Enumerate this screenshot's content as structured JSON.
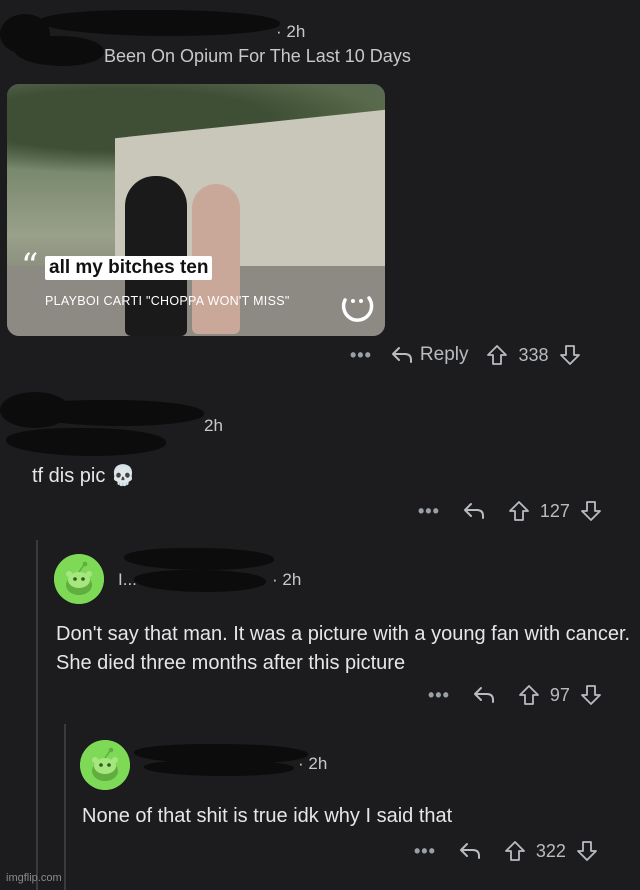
{
  "post": {
    "time": "· 2h",
    "flair": "Been On Opium For The Last 10 Days",
    "media": {
      "caption": "all my bitches ten",
      "subcaption": "PLAYBOI CARTI \"CHOPPA WON'T MISS\""
    },
    "actions": {
      "more": "•••",
      "reply": "Reply",
      "score": "338"
    }
  },
  "comments": [
    {
      "time": "2h",
      "body": "tf dis pic 💀",
      "actions": {
        "more": "•••",
        "score": "127"
      }
    },
    {
      "username_fragment": "I...",
      "time": "· 2h",
      "body": "Don't say that man. It was a picture with a young fan with cancer. She died three months after this picture",
      "actions": {
        "more": "•••",
        "score": "97"
      }
    },
    {
      "time": "· 2h",
      "body": "None of that shit is true idk why I said that",
      "actions": {
        "more": "•••",
        "score": "322"
      }
    }
  ],
  "watermark": "imgflip.com",
  "colors": {
    "background": "#1c1c1e",
    "avatar_green": "#7ed957",
    "redaction": "#0c0c0c"
  },
  "icons": [
    "reply-arrow-icon",
    "upvote-icon",
    "downvote-icon",
    "more-dots-icon",
    "snoo-avatar-icon"
  ]
}
